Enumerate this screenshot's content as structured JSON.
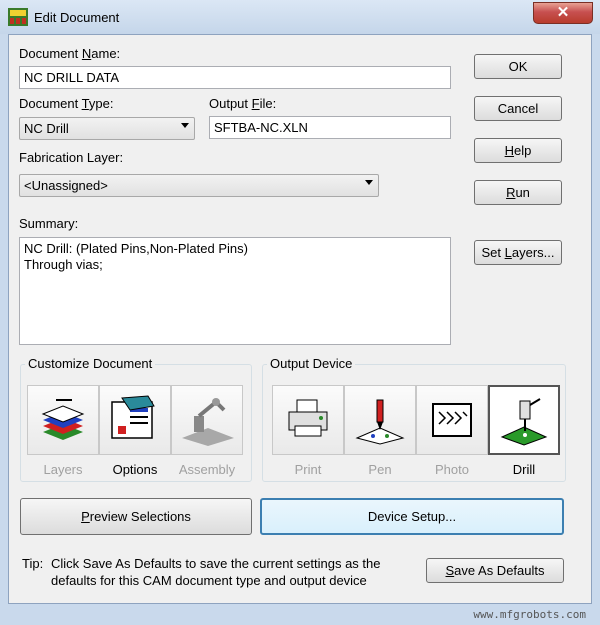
{
  "window": {
    "title": "Edit Document",
    "close_symbol": "✕"
  },
  "document_name": {
    "label_prefix": "Document ",
    "label_u": "N",
    "label_rest": "ame:",
    "value": "NC DRILL DATA"
  },
  "document_type": {
    "label_prefix": "Document ",
    "label_u": "T",
    "label_rest": "ype:",
    "selected": "NC Drill"
  },
  "output_file": {
    "label_prefix": "Output ",
    "label_u": "F",
    "label_rest": "ile:",
    "value": "SFTBA-NC.XLN"
  },
  "fabrication_layer": {
    "label": "Fabrication Layer:",
    "selected": "<Unassigned>"
  },
  "summary": {
    "label": "Summary:",
    "line1": "NC Drill: (Plated Pins,Non-Plated Pins)",
    "line2": "Through vias;"
  },
  "buttons": {
    "ok": "OK",
    "cancel": "Cancel",
    "help_u": "H",
    "help_rest": "elp",
    "run_u": "R",
    "run_rest": "un",
    "set_layers_prefix": "Set ",
    "set_layers_u": "L",
    "set_layers_rest": "ayers...",
    "preview_u": "P",
    "preview_rest": "review Selections",
    "device_setup": "Device Setup...",
    "save_defaults_u": "S",
    "save_defaults_rest": "ave As Defaults"
  },
  "customize": {
    "title": "Customize Document",
    "items": [
      {
        "label": "Layers",
        "icon": "layers-icon",
        "enabled": false
      },
      {
        "label": "Options",
        "icon": "options-icon",
        "enabled": true
      },
      {
        "label": "Assembly",
        "icon": "assembly-icon",
        "enabled": false
      }
    ]
  },
  "output_device": {
    "title": "Output Device",
    "items": [
      {
        "label": "Print",
        "icon": "printer-icon",
        "enabled": false
      },
      {
        "label": "Pen",
        "icon": "pen-plotter-icon",
        "enabled": false
      },
      {
        "label": "Photo",
        "icon": "photoplotter-icon",
        "enabled": false
      },
      {
        "label": "Drill",
        "icon": "drill-icon",
        "enabled": true,
        "selected": true
      }
    ]
  },
  "tip": {
    "prefix": "Tip:",
    "line1": "Click Save As Defaults to save the current settings as the",
    "line2": "defaults for this CAM document type and output device"
  },
  "watermark": "www.mfgrobots.com",
  "colors": {
    "accent_red": "#c75050",
    "drill_green": "#2a9a2a"
  }
}
